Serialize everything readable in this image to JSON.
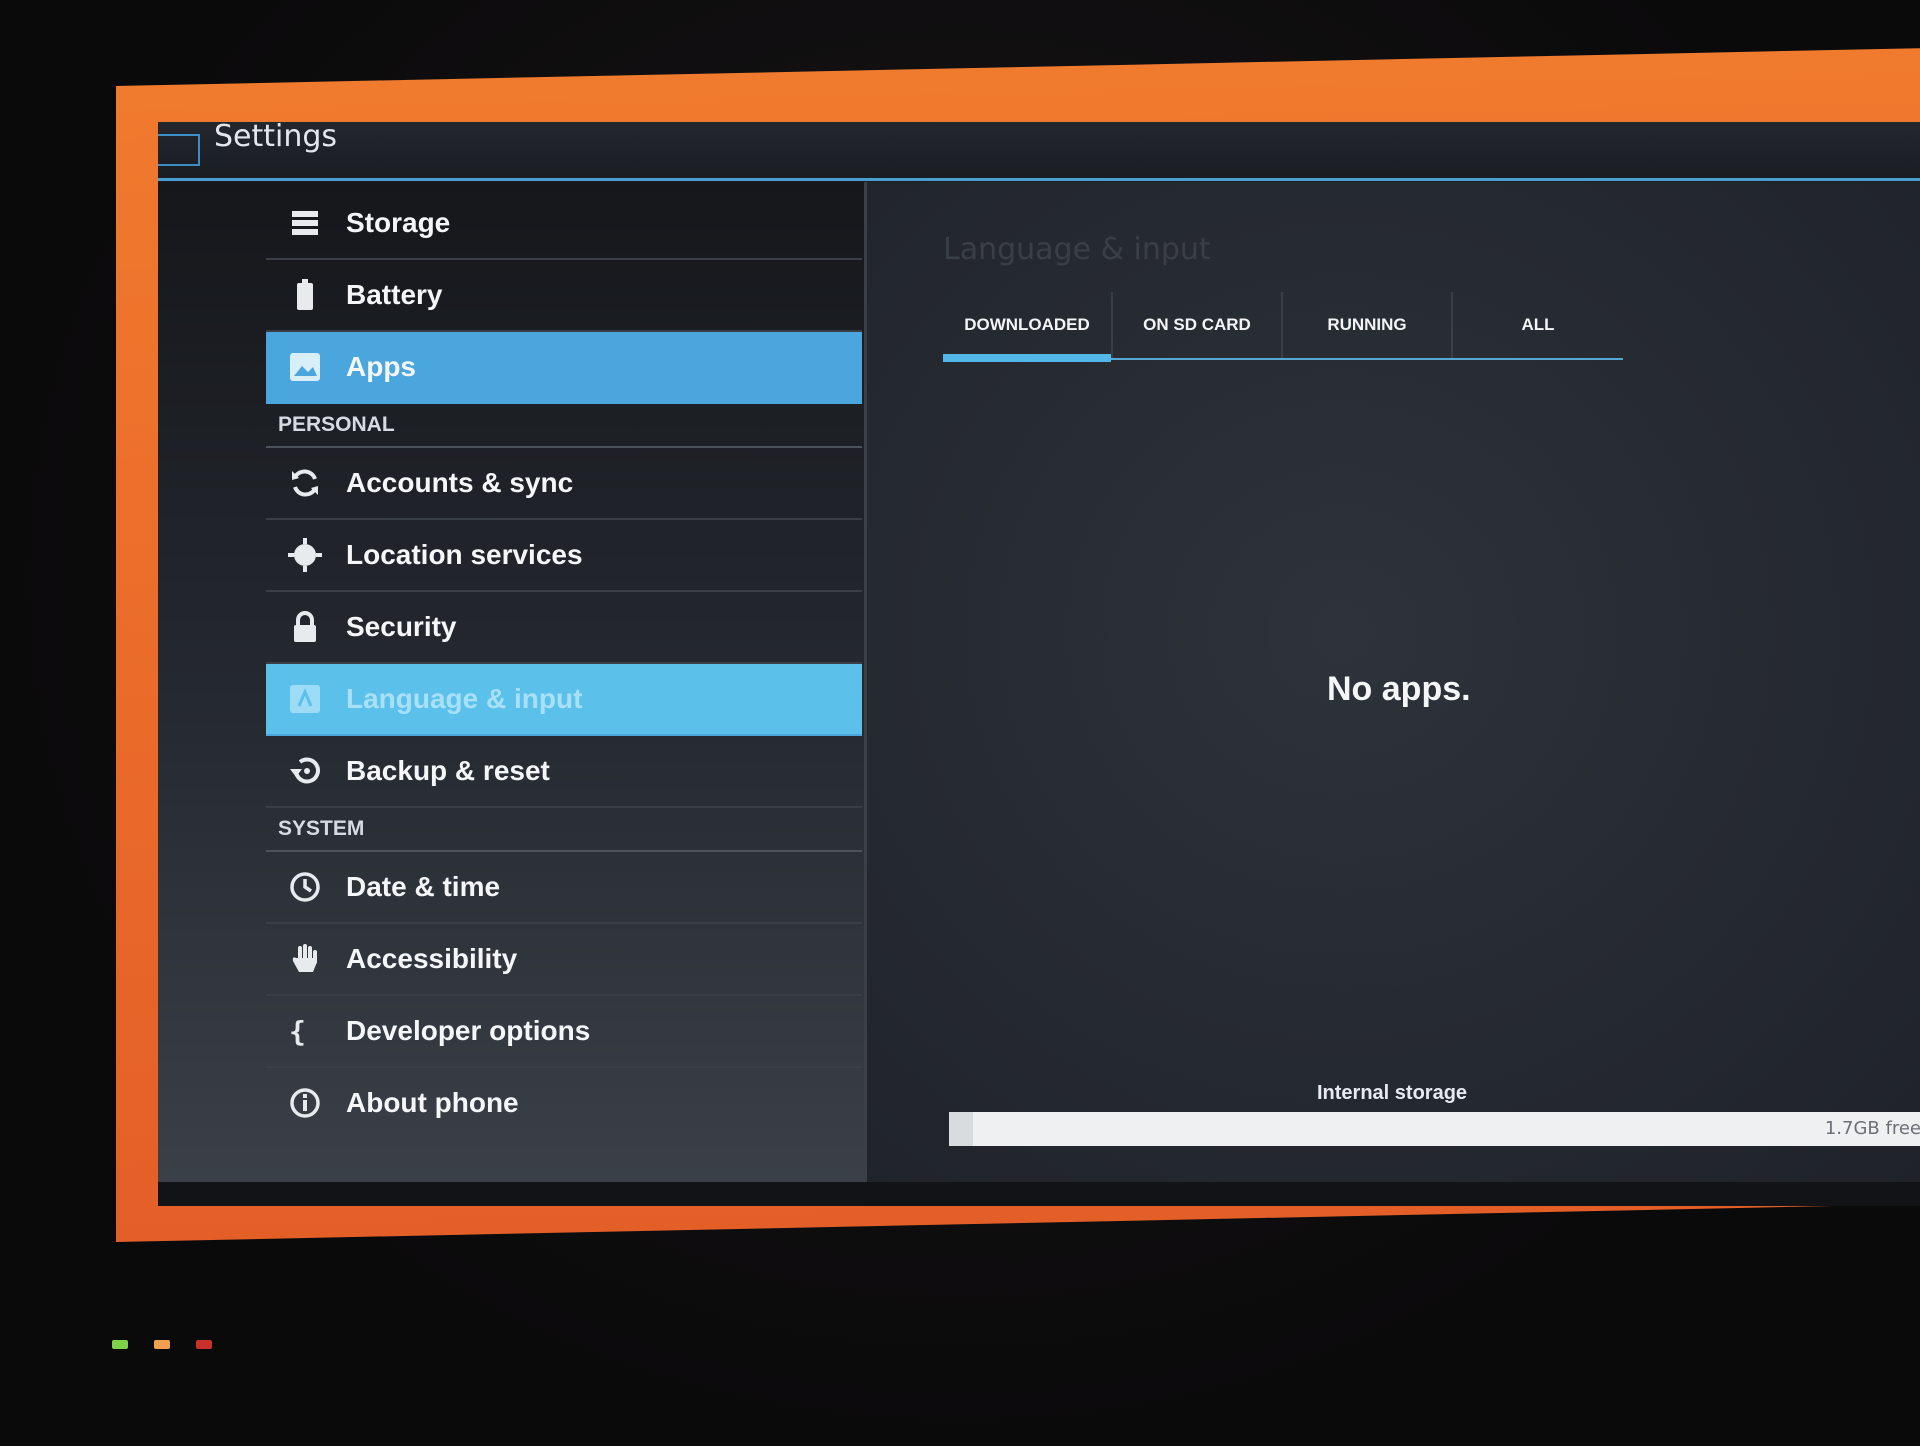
{
  "window": {
    "title": "Settings"
  },
  "sidebar": {
    "items": [
      {
        "label": "Storage",
        "icon": "storage-icon",
        "active": false
      },
      {
        "label": "Battery",
        "icon": "battery-icon",
        "active": false
      },
      {
        "label": "Apps",
        "icon": "apps-icon",
        "active": true
      }
    ],
    "personal_header": "PERSONAL",
    "personal_items": [
      {
        "label": "Accounts & sync",
        "icon": "sync-icon",
        "active": false
      },
      {
        "label": "Location services",
        "icon": "location-icon",
        "active": false
      },
      {
        "label": "Security",
        "icon": "lock-icon",
        "active": false
      },
      {
        "label": "Language & input",
        "icon": "language-icon",
        "active": true
      },
      {
        "label": "Backup & reset",
        "icon": "backup-icon",
        "active": false
      }
    ],
    "system_header": "SYSTEM",
    "system_items": [
      {
        "label": "Date & time",
        "icon": "clock-icon",
        "active": false
      },
      {
        "label": "Accessibility",
        "icon": "hand-icon",
        "active": false
      },
      {
        "label": "Developer options",
        "icon": "braces-icon",
        "active": false
      },
      {
        "label": "About phone",
        "icon": "info-icon",
        "active": false
      }
    ]
  },
  "main": {
    "tabs": [
      {
        "label": "DOWNLOADED",
        "selected": true
      },
      {
        "label": "ON SD CARD",
        "selected": false
      },
      {
        "label": "RUNNING",
        "selected": false
      },
      {
        "label": "ALL",
        "selected": false
      }
    ],
    "empty_text": "No apps.",
    "storage": {
      "label": "Internal storage",
      "free_text": "1.7GB free"
    }
  },
  "colors": {
    "accent": "#4aa6dc",
    "highlight": "#5bc0ea",
    "frame": "#ea6a2a"
  }
}
